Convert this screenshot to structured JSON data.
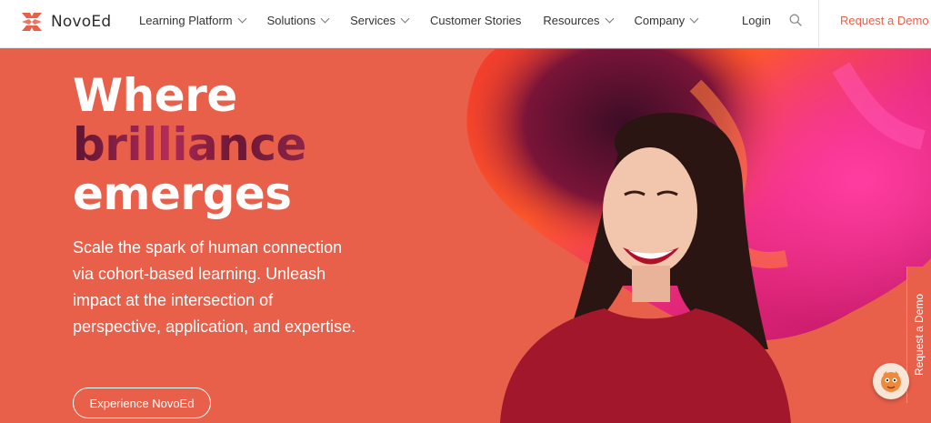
{
  "header": {
    "brand": "NovoEd",
    "nav": [
      {
        "label": "Learning Platform",
        "has_dropdown": true
      },
      {
        "label": "Solutions",
        "has_dropdown": true
      },
      {
        "label": "Services",
        "has_dropdown": true
      },
      {
        "label": "Customer Stories",
        "has_dropdown": false
      },
      {
        "label": "Resources",
        "has_dropdown": true
      },
      {
        "label": "Company",
        "has_dropdown": true
      }
    ],
    "login_label": "Login",
    "search_icon": "search-icon",
    "request_demo_label": "Request a Demo"
  },
  "hero": {
    "headline": {
      "line1": "Where",
      "line2": "brilliance",
      "line3": "emerges"
    },
    "description": "Scale the spark of human connection via cohort-based learning. Unleash impact at the intersection of perspective, application, and expertise.",
    "cta_label": "Experience NovoEd",
    "image": "smiling-woman-with-abstract-paint-background"
  },
  "side_tab": {
    "label": "Request a Demo"
  },
  "chat_widget": {
    "icon": "chat-mascot-icon"
  },
  "colors": {
    "brand": "#e8604a",
    "accent_text": "#7a1f3d",
    "header_bg": "#ffffff",
    "nav_text": "#333333"
  }
}
